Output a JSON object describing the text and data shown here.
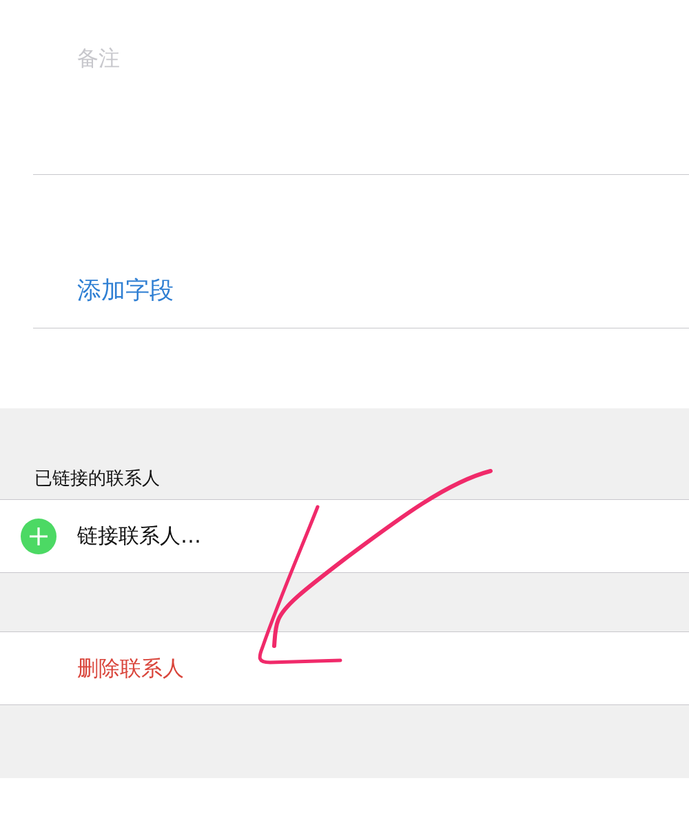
{
  "notes_field": {
    "placeholder": "备注"
  },
  "add_field_button": {
    "label": "添加字段"
  },
  "linked_contacts": {
    "header": "已链接的联系人",
    "link_button": {
      "label": "链接联系人…"
    }
  },
  "delete_button": {
    "label": "删除联系人"
  }
}
